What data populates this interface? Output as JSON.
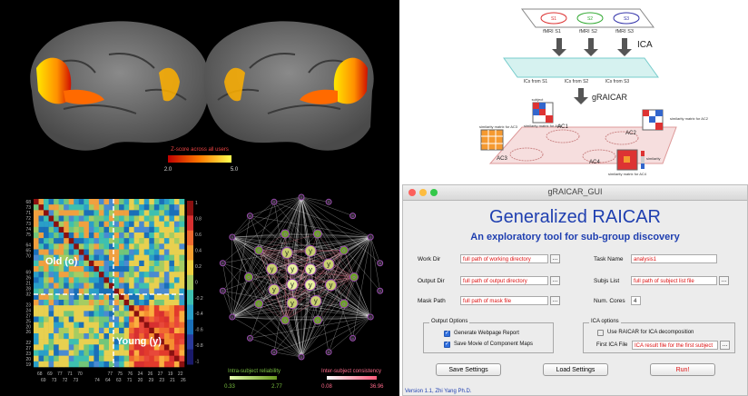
{
  "brain": {
    "colorbar_label": "Z-score across all users",
    "cbar_min": "2.0",
    "cbar_max": "5.0"
  },
  "heatmap": {
    "label_old": "Old (o)",
    "label_young": "Young (y)",
    "row_ticks": [
      "68",
      "73",
      "71",
      "72",
      "73",
      "74",
      "75",
      "",
      "64",
      "65",
      "70",
      "",
      "",
      "69",
      "26",
      "21",
      "28",
      "32",
      "",
      "23",
      "24",
      "27",
      "25",
      "20",
      "26",
      "",
      "22",
      "27",
      "23",
      "20",
      "19"
    ],
    "col_ticks_top": [
      "68",
      "69",
      "77",
      "71",
      "70",
      "",
      "",
      "77",
      "75",
      "76",
      "24",
      "26",
      "27",
      "19",
      "22"
    ],
    "col_ticks_bottom": [
      "69",
      "73",
      "72",
      "73",
      "",
      "74",
      "64",
      "63",
      "71",
      "20",
      "29",
      "23",
      "21",
      "26"
    ],
    "cbar_ticks": [
      "1",
      "0.8",
      "0.6",
      "0.4",
      "0.2",
      "0",
      "-0.2",
      "-0.4",
      "-0.6",
      "-0.8",
      "-1"
    ]
  },
  "graph": {
    "legend_intra": "Intra-subject reliability",
    "legend_inter": "Inter-subject consistency",
    "intra_min": "0.33",
    "intra_max": "2.77",
    "inter_min": "0.08",
    "inter_max": "36.96"
  },
  "diagram": {
    "fmri1": "fMRI S1",
    "fmri2": "fMRI S2",
    "fmri3": "fMRI S3",
    "s1": "S1",
    "s2": "S2",
    "s3": "S3",
    "ica_label": "ICA",
    "ics1": "ICs from S1",
    "ics2": "ICs from S2",
    "ics3": "ICs from S3",
    "graicar_label": "gRAICAR",
    "ac1": "AC1",
    "ac2": "AC2",
    "ac3": "AC3",
    "ac4": "AC4",
    "sim1": "similarity matrix for AC1",
    "sim2": "similarity matrix for AC2",
    "sim3": "similarity matrix for AC3",
    "sim4": "similarity matrix for AC4",
    "subject": "subject",
    "similarity": "similarity"
  },
  "gui": {
    "window_title": "gRAICAR_GUI",
    "title": "Generalized RAICAR",
    "subtitle": "An exploratory tool for sub-group discovery",
    "work_dir_label": "Work Dir",
    "work_dir_value": "full path of working directory",
    "output_dir_label": "Output Dir",
    "output_dir_value": "full path of output directory",
    "mask_path_label": "Mask Path",
    "mask_path_value": "full path of mask file",
    "task_name_label": "Task Name",
    "task_name_value": "analysis1",
    "subjs_list_label": "Subjs List",
    "subjs_list_value": "full path of subject list file",
    "num_cores_label": "Num. Cores",
    "num_cores_value": "4",
    "browse": "...",
    "output_options_title": "Output Options",
    "gen_report": "Generate Webpage Report",
    "save_movie": "Save Movie of Component Maps",
    "ica_options_title": "ICA options",
    "use_raicar": "Use RAICAR for ICA decomposition",
    "first_ica_label": "First ICA File",
    "first_ica_value": "ICA result file for the first subject",
    "save_settings": "Save Settings",
    "load_settings": "Load Settings",
    "run": "Run!",
    "version": "Version 1.1, Zhi Yang Ph.D."
  },
  "colors": {
    "gui_title": "#1f3fb0",
    "field_text": "#dd1111",
    "run_text": "#dd1111"
  }
}
